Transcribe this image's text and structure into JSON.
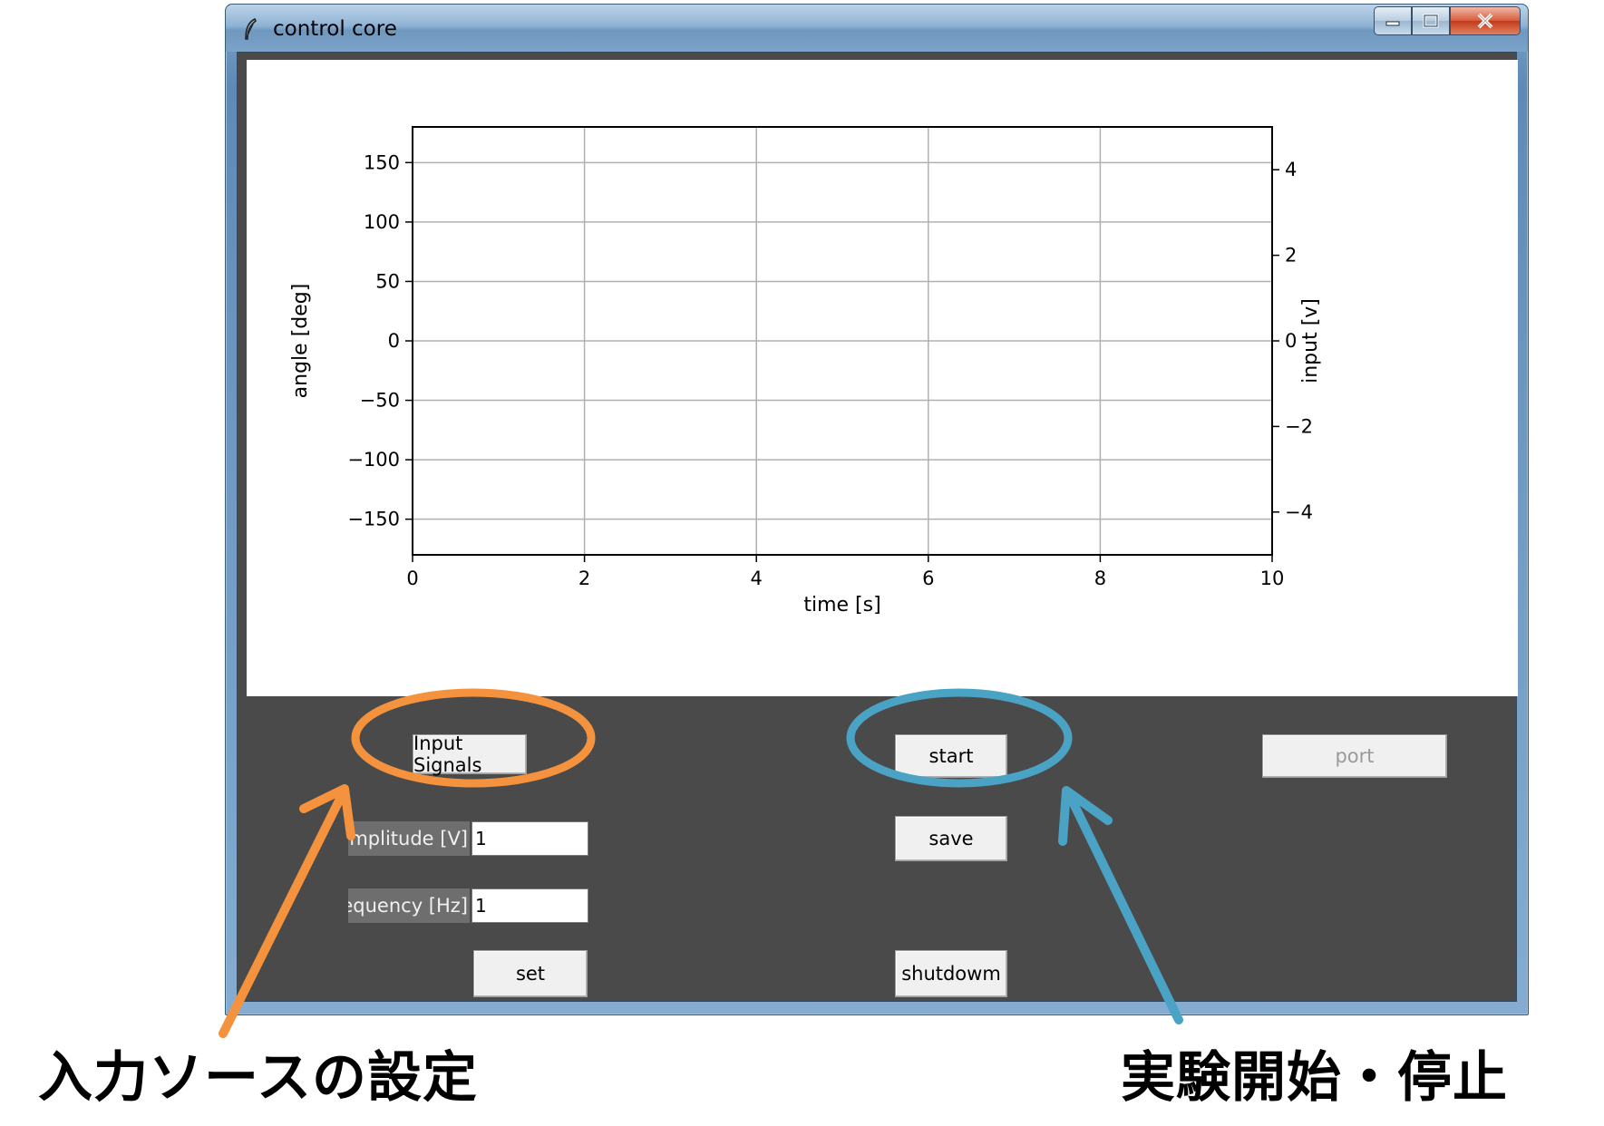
{
  "window": {
    "title": "control core"
  },
  "chart_data": {
    "type": "line",
    "xlabel": "time [s]",
    "ylabel": "angle [deg]",
    "y2label": "input [v]",
    "xlim": [
      0,
      10
    ],
    "ylim": [
      -180,
      180
    ],
    "y2lim": [
      -5,
      5
    ],
    "xticks": [
      0,
      2,
      4,
      6,
      8,
      10
    ],
    "yticks": [
      -150,
      -100,
      -50,
      0,
      50,
      100,
      150
    ],
    "y2ticks": [
      -4,
      -2,
      0,
      2,
      4
    ],
    "grid": true,
    "series": []
  },
  "controls": {
    "input_signals_label": "Input Signals",
    "start_label": "start",
    "port_label": "port",
    "amplitude_label": "amplitude [V]",
    "amplitude_value": "1",
    "save_label": "save",
    "frequency_label": "frequency [Hz]",
    "frequency_value": "1",
    "set_label": "set",
    "shutdown_label": "shutdowm"
  },
  "annotations": {
    "left_caption": "入力ソースの設定",
    "right_caption": "実験開始・停止",
    "left_color": "#f5923e",
    "right_color": "#4aa3c4"
  }
}
